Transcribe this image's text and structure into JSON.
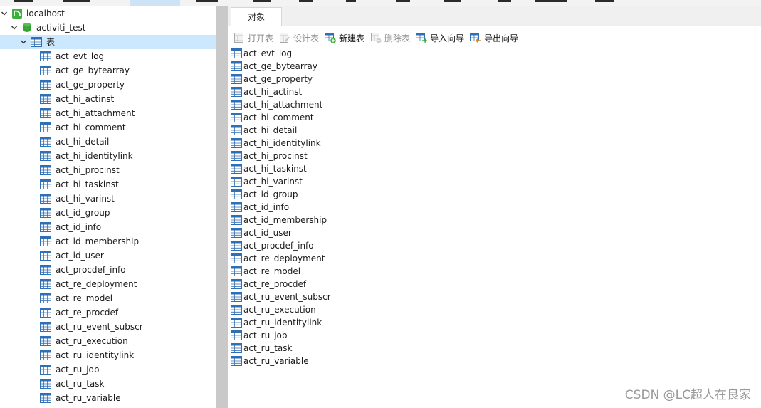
{
  "tree": {
    "connection": "localhost",
    "database": "activiti_test",
    "tables_folder": "表",
    "tables": [
      "act_evt_log",
      "act_ge_bytearray",
      "act_ge_property",
      "act_hi_actinst",
      "act_hi_attachment",
      "act_hi_comment",
      "act_hi_detail",
      "act_hi_identitylink",
      "act_hi_procinst",
      "act_hi_taskinst",
      "act_hi_varinst",
      "act_id_group",
      "act_id_info",
      "act_id_membership",
      "act_id_user",
      "act_procdef_info",
      "act_re_deployment",
      "act_re_model",
      "act_re_procdef",
      "act_ru_event_subscr",
      "act_ru_execution",
      "act_ru_identitylink",
      "act_ru_job",
      "act_ru_task",
      "act_ru_variable"
    ]
  },
  "tabs": [
    {
      "label": "对象"
    }
  ],
  "toolbar": {
    "buttons": [
      {
        "label": "打开表",
        "icon": "open-table-icon",
        "enabled": false
      },
      {
        "label": "设计表",
        "icon": "design-table-icon",
        "enabled": false
      },
      {
        "label": "新建表",
        "icon": "new-table-icon",
        "enabled": true
      },
      {
        "label": "删除表",
        "icon": "delete-table-icon",
        "enabled": false
      },
      {
        "label": "导入向导",
        "icon": "import-wizard-icon",
        "enabled": true
      },
      {
        "label": "导出向导",
        "icon": "export-wizard-icon",
        "enabled": true
      }
    ]
  },
  "objects": [
    "act_evt_log",
    "act_ge_bytearray",
    "act_ge_property",
    "act_hi_actinst",
    "act_hi_attachment",
    "act_hi_comment",
    "act_hi_detail",
    "act_hi_identitylink",
    "act_hi_procinst",
    "act_hi_taskinst",
    "act_hi_varinst",
    "act_id_group",
    "act_id_info",
    "act_id_membership",
    "act_id_user",
    "act_procdef_info",
    "act_re_deployment",
    "act_re_model",
    "act_re_procdef",
    "act_ru_event_subscr",
    "act_ru_execution",
    "act_ru_identitylink",
    "act_ru_job",
    "act_ru_task",
    "act_ru_variable"
  ],
  "watermark": "CSDN @LC超人在良家",
  "colors": {
    "selection": "#cce8ff",
    "splitter": "#c9c9c9",
    "table_icon": "#2f6fb6",
    "connection_icon": "#3fae3f",
    "database_icon": "#3fae3f"
  }
}
